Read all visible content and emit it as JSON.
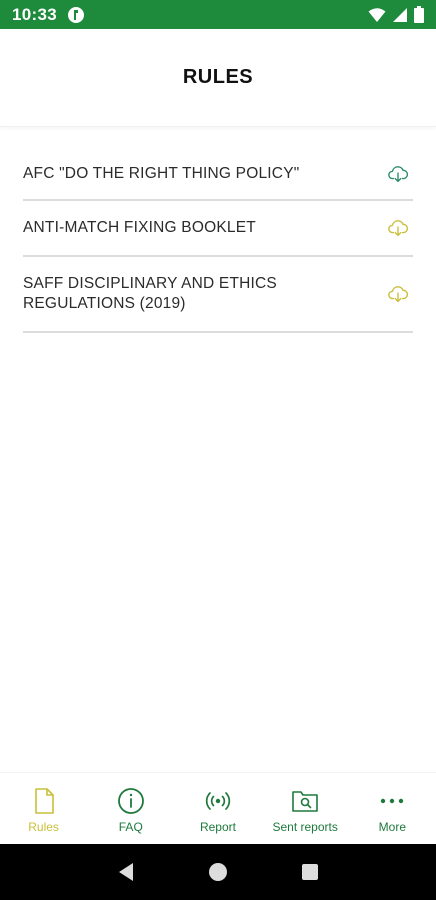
{
  "status_bar": {
    "time": "10:33",
    "icons": [
      "app-notification-icon",
      "wifi-icon",
      "signal-icon",
      "battery-icon"
    ]
  },
  "header": {
    "title": "RULES"
  },
  "rules": [
    {
      "label": "AFC \"DO THE RIGHT THING POLICY\"",
      "icon": "cloud-download-icon",
      "icon_color": "#2e8b6e"
    },
    {
      "label": "ANTI-MATCH FIXING BOOKLET",
      "icon": "cloud-download-icon",
      "icon_color": "#c9bf3a"
    },
    {
      "label": "SAFF DISCIPLINARY AND ETHICS REGULATIONS (2019)",
      "icon": "cloud-download-icon",
      "icon_color": "#c9bf3a"
    }
  ],
  "bottom_nav": {
    "items": [
      {
        "label": "Rules",
        "icon": "document-icon",
        "active": true
      },
      {
        "label": "FAQ",
        "icon": "info-icon",
        "active": false
      },
      {
        "label": "Report",
        "icon": "broadcast-icon",
        "active": false
      },
      {
        "label": "Sent reports",
        "icon": "folder-search-icon",
        "active": false
      },
      {
        "label": "More",
        "icon": "more-dots-icon",
        "active": false
      }
    ]
  },
  "system_nav": [
    "back-icon",
    "home-icon",
    "recents-icon"
  ],
  "colors": {
    "status_bar": "#1e8a3c",
    "nav_green": "#1e7a3c",
    "active_yellow": "#c9bf3a",
    "divider": "#dcdcdc"
  }
}
